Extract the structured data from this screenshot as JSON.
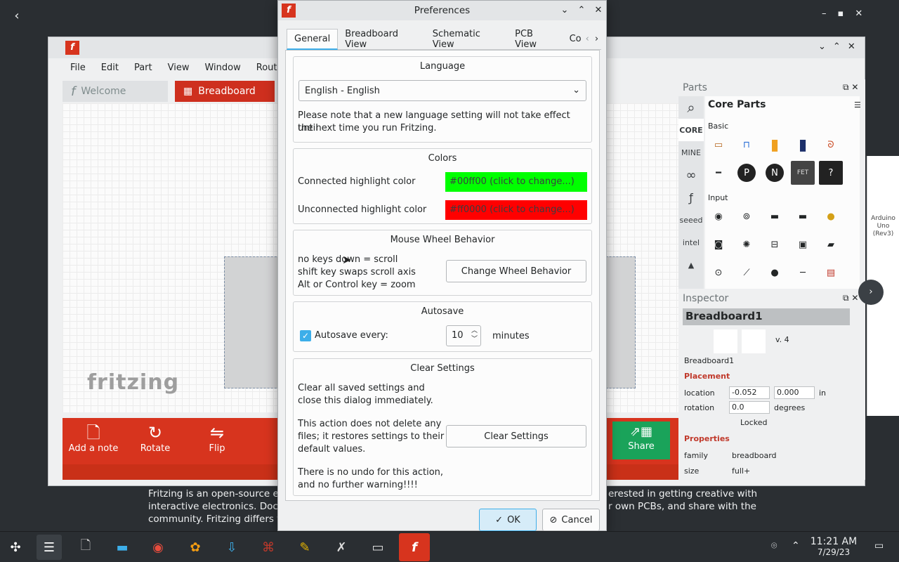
{
  "desktop": {
    "bg_text_lines": [
      "Fritzing is an open-source el",
      "interactive electronics. Docu",
      "community. Fritzing differs f"
    ],
    "bg_text_right_lines": [
      "erested in getting creative with",
      "r own PCBs, and share with the"
    ]
  },
  "main_window": {
    "menu": [
      "File",
      "Edit",
      "Part",
      "View",
      "Window",
      "Routing"
    ],
    "tabs": {
      "welcome": "Welcome",
      "breadboard": "Breadboard"
    },
    "logo_text": "fritzing",
    "toolbar": {
      "add_note": "Add a note",
      "rotate": "Rotate",
      "flip": "Flip",
      "share": "Share"
    }
  },
  "parts": {
    "title": "Parts",
    "bin_title": "Core Parts",
    "side_labels": {
      "core": "CORE",
      "mine": "MINE"
    },
    "sections": {
      "basic": "Basic",
      "input": "Input"
    }
  },
  "inspector": {
    "title": "Inspector",
    "part_name": "Breadboard1",
    "version": "v. 4",
    "part_label": "Breadboard1",
    "placement_heading": "Placement",
    "location_label": "location",
    "location_x": "-0.052",
    "location_y": "0.000",
    "location_unit": "in",
    "rotation_label": "rotation",
    "rotation_value": "0.0",
    "rotation_unit": "degrees",
    "locked_label": "Locked",
    "properties_heading": "Properties",
    "family_label": "family",
    "family_value": "breadboard",
    "size_label": "size",
    "size_value": "full+"
  },
  "dialog": {
    "title": "Preferences",
    "tabs": [
      "General",
      "Breadboard View",
      "Schematic View",
      "PCB View",
      "Co"
    ],
    "language": {
      "title": "Language",
      "selected": "English - English",
      "note_line1": "Please note that a new language setting will not take effect until",
      "note_line2": "the next time you run Fritzing."
    },
    "colors": {
      "title": "Colors",
      "connected_label": "Connected highlight color",
      "connected_value": "#00ff00 (click to change...)",
      "connected_color": "#00ff00",
      "unconnected_label": "Unconnected highlight color",
      "unconnected_value": "#ff0000 (click to change...)",
      "unconnected_color": "#ff0000"
    },
    "mouse_wheel": {
      "title": "Mouse Wheel Behavior",
      "line1": "no keys down = scroll",
      "line2": "shift key swaps scroll axis",
      "line3": "Alt or Control key = zoom",
      "button": "Change Wheel Behavior"
    },
    "autosave": {
      "title": "Autosave",
      "checkbox_label": "Autosave every:",
      "checked": true,
      "value": "10",
      "unit": "minutes"
    },
    "clear_settings": {
      "title": "Clear Settings",
      "text1_line1": "Clear all saved settings and",
      "text1_line2": "close this dialog immediately.",
      "text2_line1": "This action does not delete any",
      "text2_line2": "files; it restores settings to their",
      "text2_line3": "default values.",
      "text3_line1": "There is no undo for this action,",
      "text3_line2": "and no further warning!!!!",
      "button": "Clear Settings"
    },
    "ok": "OK",
    "cancel": "Cancel"
  },
  "taskbar": {
    "time": "11:21 AM",
    "date": "7/29/23"
  }
}
